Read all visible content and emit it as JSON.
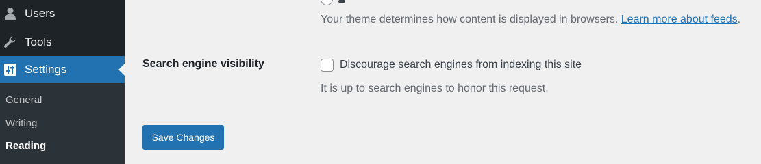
{
  "sidebar": {
    "menu": [
      {
        "label": "Users",
        "icon": "user-icon"
      },
      {
        "label": "Tools",
        "icon": "wrench-icon"
      },
      {
        "label": "Settings",
        "icon": "settings-sliders-icon",
        "active": true
      }
    ],
    "submenu": [
      {
        "label": "General"
      },
      {
        "label": "Writing"
      },
      {
        "label": "Reading",
        "current": true
      }
    ]
  },
  "main": {
    "feed_description": "Your theme determines how content is displayed in browsers.",
    "feed_link": "Learn more about feeds",
    "feed_period": ".",
    "search_visibility": {
      "label": "Search engine visibility",
      "checkbox_label": "Discourage search engines from indexing this site",
      "checked": false,
      "description": "It is up to search engines to honor this request."
    },
    "save_button": "Save Changes"
  },
  "colors": {
    "sidebar_bg": "#1d2327",
    "submenu_bg": "#2c3338",
    "accent": "#2271b1",
    "page_bg": "#f0f0f1",
    "muted_text": "#646970"
  }
}
